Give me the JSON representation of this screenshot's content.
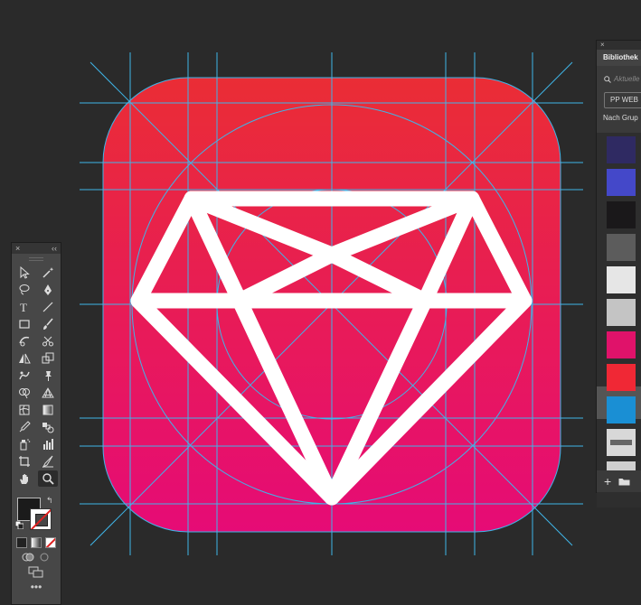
{
  "canvas": {
    "icon_gradient_top": "#ea2d35",
    "icon_gradient_bottom": "#e60b76",
    "guide_color": "#3fb5e8",
    "diamond_color": "#ffffff"
  },
  "tools_panel": {
    "close_glyph": "×",
    "collapse_glyph": "‹‹",
    "more_glyph": "•••",
    "tools": [
      {
        "name": "selection-tool",
        "icon": "arrow-icon"
      },
      {
        "name": "magic-wand-tool",
        "icon": "wand-icon"
      },
      {
        "name": "lasso-tool",
        "icon": "lasso-icon"
      },
      {
        "name": "pen-tool",
        "icon": "pen-icon"
      },
      {
        "name": "type-tool",
        "icon": "type-icon"
      },
      {
        "name": "line-tool",
        "icon": "line-icon"
      },
      {
        "name": "rectangle-tool",
        "icon": "rectangle-icon"
      },
      {
        "name": "paintbrush-tool",
        "icon": "brush-icon"
      },
      {
        "name": "shaper-tool",
        "icon": "shaper-icon"
      },
      {
        "name": "scissors-tool",
        "icon": "scissors-icon"
      },
      {
        "name": "reflect-tool",
        "icon": "reflect-icon"
      },
      {
        "name": "scale-tool",
        "icon": "scale-icon"
      },
      {
        "name": "warp-tool",
        "icon": "warp-icon"
      },
      {
        "name": "puppet-warp-tool",
        "icon": "pin-icon"
      },
      {
        "name": "shape-builder-tool",
        "icon": "shape-builder-icon"
      },
      {
        "name": "perspective-grid-tool",
        "icon": "perspective-icon"
      },
      {
        "name": "mesh-tool",
        "icon": "mesh-icon"
      },
      {
        "name": "gradient-tool",
        "icon": "gradient-icon"
      },
      {
        "name": "eyedropper-tool",
        "icon": "eyedropper-icon"
      },
      {
        "name": "blend-tool",
        "icon": "blend-icon"
      },
      {
        "name": "symbol-sprayer-tool",
        "icon": "sprayer-icon"
      },
      {
        "name": "column-graph-tool",
        "icon": "graph-icon"
      },
      {
        "name": "artboard-tool",
        "icon": "artboard-icon"
      },
      {
        "name": "slice-tool",
        "icon": "slice-icon"
      },
      {
        "name": "hand-tool",
        "icon": "hand-icon"
      },
      {
        "name": "zoom-tool",
        "icon": "zoom-icon"
      }
    ]
  },
  "libraries_panel": {
    "close_glyph": "×",
    "title": "Bibliothek",
    "search_placeholder": "Aktuelle",
    "library_select": "PP WEB",
    "group_label": "Nach Grup",
    "add_glyph": "+",
    "folder_icon": "folder-icon",
    "swatches": [
      {
        "color": "#2f2a62"
      },
      {
        "color": "#4448c9"
      },
      {
        "color": "#1a181a"
      },
      {
        "color": "#5c5c5c"
      },
      {
        "color": "#e6e6e6"
      },
      {
        "color": "#c4c4c4"
      },
      {
        "color": "#e0126a"
      },
      {
        "color": "#f02835"
      },
      {
        "color": "#1a8fd4"
      },
      {
        "color": "#d8d8d8"
      },
      {
        "color": "#cfcfcf"
      }
    ]
  }
}
